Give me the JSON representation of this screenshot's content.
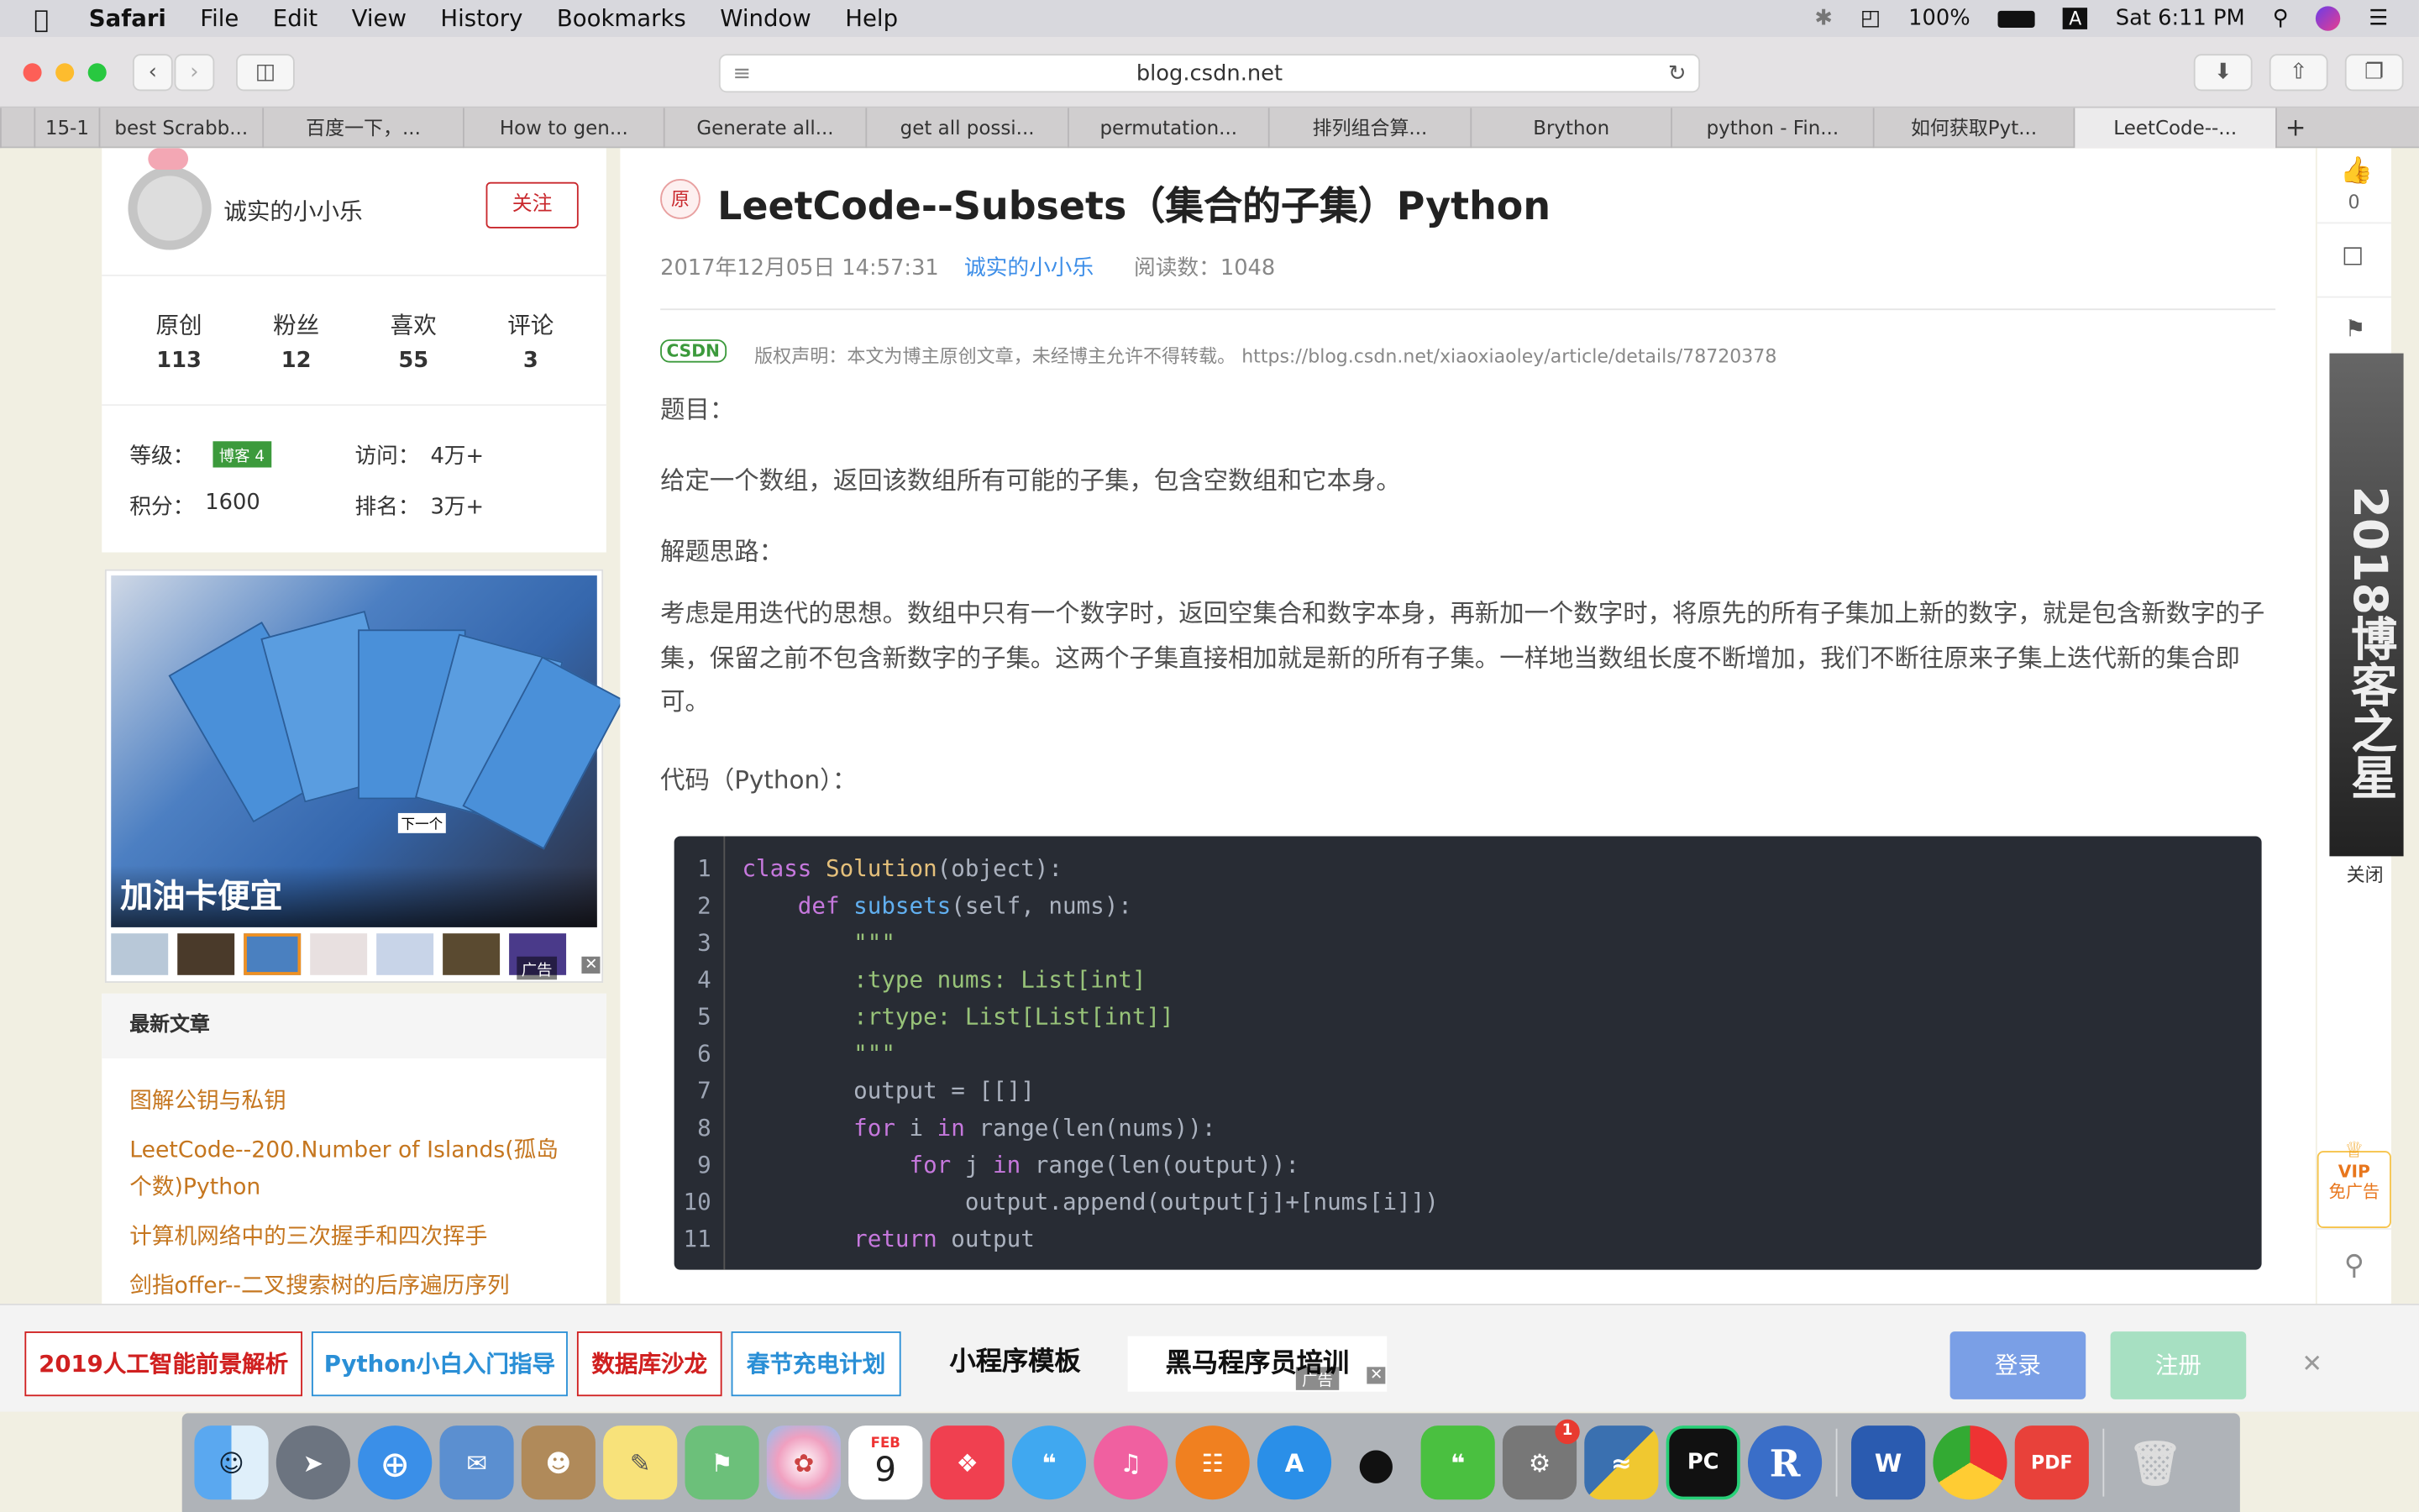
{
  "menubar": {
    "app": "Safari",
    "items": [
      "File",
      "Edit",
      "View",
      "History",
      "Bookmarks",
      "Window",
      "Help"
    ],
    "battery": "100%",
    "input_source": "A",
    "clock": "Sat 6:11 PM"
  },
  "toolbar": {
    "url": "blog.csdn.net"
  },
  "tabs": [
    {
      "label": "15-1"
    },
    {
      "label": "best Scrabb..."
    },
    {
      "label": "百度一下，..."
    },
    {
      "label": "How to gen..."
    },
    {
      "label": "Generate all..."
    },
    {
      "label": "get all possi..."
    },
    {
      "label": "permutation..."
    },
    {
      "label": "排列组合算..."
    },
    {
      "label": "Brython"
    },
    {
      "label": "python - Fin..."
    },
    {
      "label": "如何获取Pyt..."
    },
    {
      "label": "LeetCode--..."
    }
  ],
  "profile": {
    "name": "诚实的小小乐",
    "follow": "关注",
    "stats": [
      {
        "label": "原创",
        "value": "113"
      },
      {
        "label": "粉丝",
        "value": "12"
      },
      {
        "label": "喜欢",
        "value": "55"
      },
      {
        "label": "评论",
        "value": "3"
      }
    ],
    "level_label": "等级：",
    "level_badge": "博客 4",
    "visits_label": "访问：",
    "visits_value": "4万+",
    "points_label": "积分：",
    "points_value": "1600",
    "rank_label": "排名：",
    "rank_value": "3万+"
  },
  "ad": {
    "caption": "加油卡便宜",
    "next": "下一个",
    "ad_label": "广告"
  },
  "latest": {
    "heading": "最新文章",
    "items": [
      "图解公钥与私钥",
      "LeetCode--200.Number of Islands(孤岛个数)Python",
      "计算机网络中的三次握手和四次挥手",
      "剑指offer--二叉搜索树的后序遍历序列"
    ]
  },
  "article": {
    "badge": "原",
    "title": "LeetCode--Subsets（集合的子集）Python",
    "date": "2017年12月05日 14:57:31",
    "author": "诚实的小小乐",
    "reads": "阅读数：1048",
    "csdn_logo": "CSDN",
    "copyright": "版权声明：本文为博主原创文章，未经博主允许不得转载。 https://blog.csdn.net/xiaoxiaoley/article/details/78720378",
    "p1": "题目：",
    "p2": "给定一个数组，返回该数组所有可能的子集，包含空数组和它本身。",
    "p3": "解题思路：",
    "p4": "考虑是用迭代的思想。数组中只有一个数字时，返回空集合和数字本身，再新加一个数字时，将原先的所有子集加上新的数字，就是包含新数字的子集，保留之前不包含新数字的子集。这两个子集直接相加就是新的所有子集。一样地当数组长度不断增加，我们不断往原来子集上迭代新的集合即可。",
    "p5": "代码（Python）："
  },
  "code": {
    "line_numbers": [
      "1",
      "2",
      "3",
      "4",
      "5",
      "6",
      "7",
      "8",
      "9",
      "10",
      "11"
    ]
  },
  "rail": {
    "likes": "0",
    "banner": "2018博客之星",
    "close": "关闭",
    "vip_line1": "VIP",
    "vip_line2": "免广告"
  },
  "bottom": {
    "links": [
      "2019人工智能前景解析",
      "Python小白入门指导",
      "数据库沙龙",
      "春节充电计划",
      "小程序模板",
      "黑马程序员培训"
    ],
    "ad_label": "广告",
    "login": "登录",
    "register": "注册"
  },
  "dock": {
    "calendar_month": "FEB",
    "calendar_day": "9",
    "badge": "1"
  },
  "colors": {
    "accent_red": "#c9282d",
    "link_blue": "#3d8ee8",
    "orange_link": "#c5761f",
    "code_bg": "#282c34"
  }
}
